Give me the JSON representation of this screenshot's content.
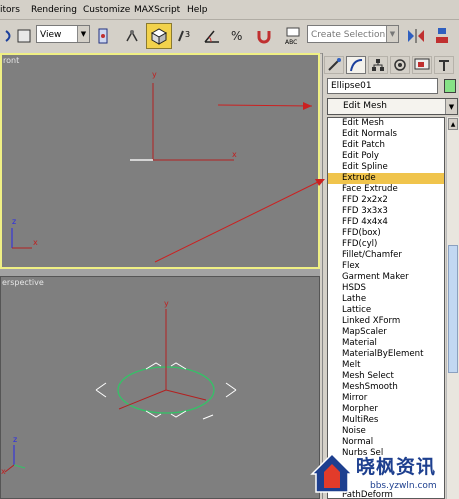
{
  "menubar": {
    "items": [
      "itors",
      "Rendering",
      "Customize",
      "MAXScript",
      "Help"
    ]
  },
  "toolbar": {
    "view_combo": "View",
    "selection_set_placeholder": "Create Selection Set"
  },
  "viewports": {
    "front_label": "ront",
    "perspective_label": "erspective",
    "axis_x": "x",
    "axis_y": "y",
    "axis_z": "z"
  },
  "command_panel": {
    "object_name": "Ellipse01",
    "object_color": "#86e286",
    "modifier_selected": "Edit Mesh"
  },
  "modifier_list": {
    "highlighted": "Extrude",
    "items": [
      "Edit Mesh",
      "Edit Normals",
      "Edit Patch",
      "Edit Poly",
      "Edit Spline",
      "Extrude",
      "Face Extrude",
      "FFD 2x2x2",
      "FFD 3x3x3",
      "FFD 4x4x4",
      "FFD(box)",
      "FFD(cyl)",
      "Fillet/Chamfer",
      "Flex",
      "Garment Maker",
      "HSDS",
      "Lathe",
      "Lattice",
      "Linked XForm",
      "MapScaler",
      "Material",
      "MaterialByElement",
      "Melt",
      "Mesh Select",
      "MeshSmooth",
      "Mirror",
      "Morpher",
      "MultiRes",
      "Noise",
      "Normal",
      "Nurbs Sel",
      "PathDeform"
    ]
  },
  "watermark": {
    "title": "晓枫资讯",
    "url": "bbs.yzwln.com"
  },
  "colors": {
    "viewport_bg": "#7f7f7f",
    "active_border": "#f0f084",
    "highlight": "#f0c44c",
    "annotation_arrow": "#cc2020"
  }
}
